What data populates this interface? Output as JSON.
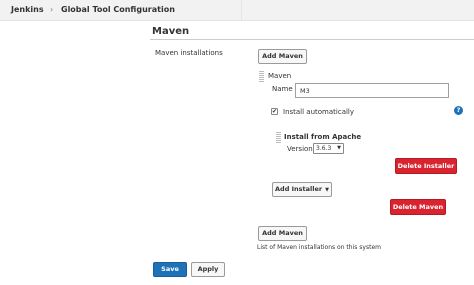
{
  "breadcrumb": {
    "root": "Jenkins",
    "separator": "›",
    "current": "Global Tool Configuration"
  },
  "section": {
    "title": "Maven"
  },
  "installations": {
    "label": "Maven installations",
    "add_maven_label": "Add Maven",
    "entry": {
      "header": "Maven",
      "name_label": "Name",
      "name_value": "M3",
      "install_auto_label": "Install automatically",
      "install_auto_checked": true,
      "help_glyph": "?",
      "installer": {
        "header": "Install from Apache",
        "version_label": "Version",
        "version_value": "3.6.3",
        "delete_installer_label": "Delete Installer"
      },
      "add_installer_label": "Add Installer",
      "delete_maven_label": "Delete Maven"
    },
    "add_maven_bottom_label": "Add Maven",
    "description": "List of Maven installations on this system"
  },
  "actions": {
    "save_label": "Save",
    "apply_label": "Apply"
  },
  "icons": {
    "checkbox": "check-icon",
    "help": "help-icon",
    "drag_handle": "drag-handle-icon",
    "dropdown": "caret-down-icon"
  },
  "colors": {
    "primary": "#1d72b8",
    "danger": "#d9232f",
    "header_bg": "#f2f2f2"
  }
}
